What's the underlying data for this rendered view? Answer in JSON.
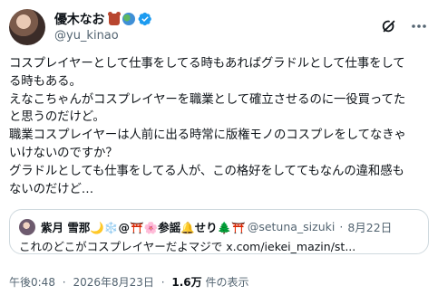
{
  "author": {
    "display_name": "優木なお",
    "handle": "@yu_kinao"
  },
  "post": {
    "lines": [
      "コスプレイヤーとして仕事をしてる時もあればグラドルとして仕事をして",
      "る時もある。",
      "えなこちゃんがコスプレイヤーを職業として確立させるのに一役買ってた",
      "と思うのだけど。",
      "職業コスプレイヤーは人前に出る時常に版権モノのコスプレをしてなきゃ",
      "いけないのですか？",
      "グラドルとしても仕事をしてる人が、この格好をしててもなんの違和感も",
      "ないのだけど…"
    ]
  },
  "quote": {
    "display_name": "紫月 雪那🌙❄️@⛩️🌸参謡🔔せり🌲⛩️",
    "handle": "@setuna_sizuki",
    "separator": "·",
    "date": "8月22日",
    "text": "これのどこがコスプレイヤーだよマジで",
    "link": "x.com/iekei_mazin/st..."
  },
  "meta": {
    "time": "午後0:48",
    "separator": "·",
    "date": "2026年8月23日",
    "views_count": "1.6万",
    "views_label": "件の表示"
  },
  "icons": {
    "verified": "verified-badge-icon",
    "grok": "grok-icon",
    "more": "more-options-icon"
  },
  "colors": {
    "verified": "#1d9bf0",
    "text": "#0f1419",
    "secondary": "#536471",
    "border": "#cfd9de"
  }
}
